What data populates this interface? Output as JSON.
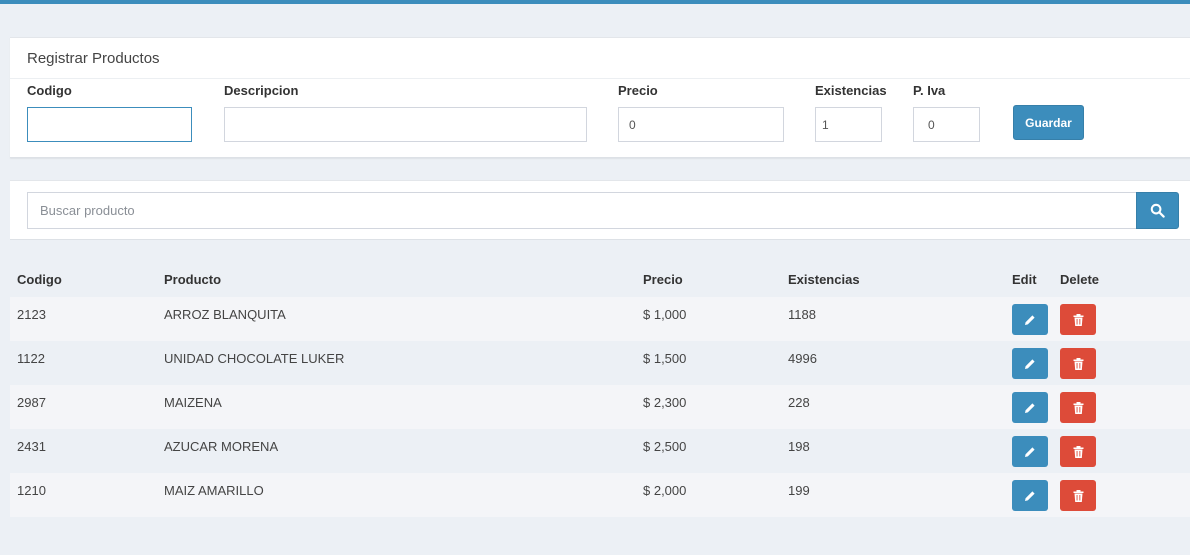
{
  "register": {
    "title": "Registrar Productos",
    "fields": {
      "codigo": {
        "label": "Codigo",
        "value": ""
      },
      "descripcion": {
        "label": "Descripcion",
        "value": ""
      },
      "precio": {
        "label": "Precio",
        "value": "0"
      },
      "existencias": {
        "label": "Existencias",
        "value": "1"
      },
      "iva": {
        "label": "P. Iva",
        "value": "0"
      }
    },
    "save_label": "Guardar"
  },
  "search": {
    "placeholder": "Buscar producto",
    "icon": "search-icon"
  },
  "table": {
    "headers": {
      "codigo": "Codigo",
      "producto": "Producto",
      "precio": "Precio",
      "existencias": "Existencias",
      "edit": "Edit",
      "delete": "Delete"
    },
    "rows": [
      {
        "codigo": "2123",
        "producto": "ARROZ BLANQUITA",
        "precio": "$ 1,000",
        "existencias": "1188"
      },
      {
        "codigo": "1122",
        "producto": "UNIDAD CHOCOLATE LUKER",
        "precio": "$ 1,500",
        "existencias": "4996"
      },
      {
        "codigo": "2987",
        "producto": "MAIZENA",
        "precio": "$ 2,300",
        "existencias": "228"
      },
      {
        "codigo": "2431",
        "producto": "AZUCAR MORENA",
        "precio": "$ 2,500",
        "existencias": "198"
      },
      {
        "codigo": "1210",
        "producto": "MAIZ AMARILLO",
        "precio": "$ 2,000",
        "existencias": "199"
      }
    ]
  },
  "colors": {
    "primary": "#3c8dbc",
    "danger": "#dd4b39",
    "background": "#ecf0f5"
  }
}
